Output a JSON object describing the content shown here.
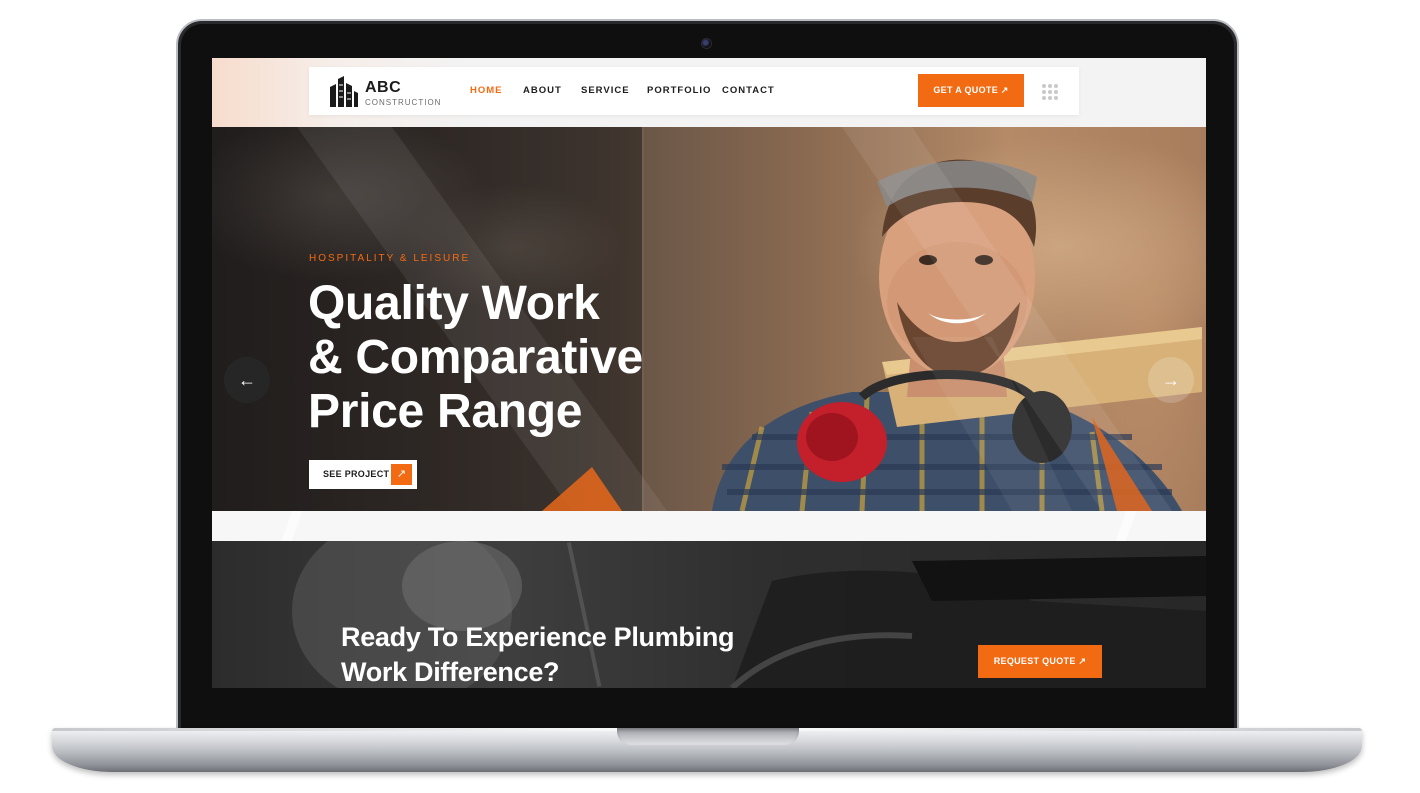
{
  "brand": {
    "name": "ABC",
    "tagline": "CONSTRUCTION"
  },
  "nav": {
    "items": [
      {
        "label": "HOME",
        "active": true
      },
      {
        "label": "ABOUT",
        "active": false
      },
      {
        "label": "SERVICE",
        "active": false
      },
      {
        "label": "PORTFOLIO",
        "active": false
      },
      {
        "label": "CONTACT",
        "active": false
      }
    ],
    "quote_label": "GET A QUOTE ↗"
  },
  "hero": {
    "eyebrow": "HOSPITALITY & LEISURE",
    "title_lines": [
      "Quality Work",
      "& Comparative",
      "Price Range"
    ],
    "button_label": "SEE PROJECT",
    "button_icon": "arrow-up-right-icon",
    "prev_icon": "arrow-left-icon",
    "next_icon": "arrow-right-icon"
  },
  "cta": {
    "title_lines": [
      "Ready To Experience Plumbing",
      "Work Difference?"
    ],
    "button_label": "REQUEST QUOTE ↗"
  },
  "colors": {
    "accent": "#f26a12",
    "dark": "#1d1d1d",
    "light": "#ffffff"
  }
}
